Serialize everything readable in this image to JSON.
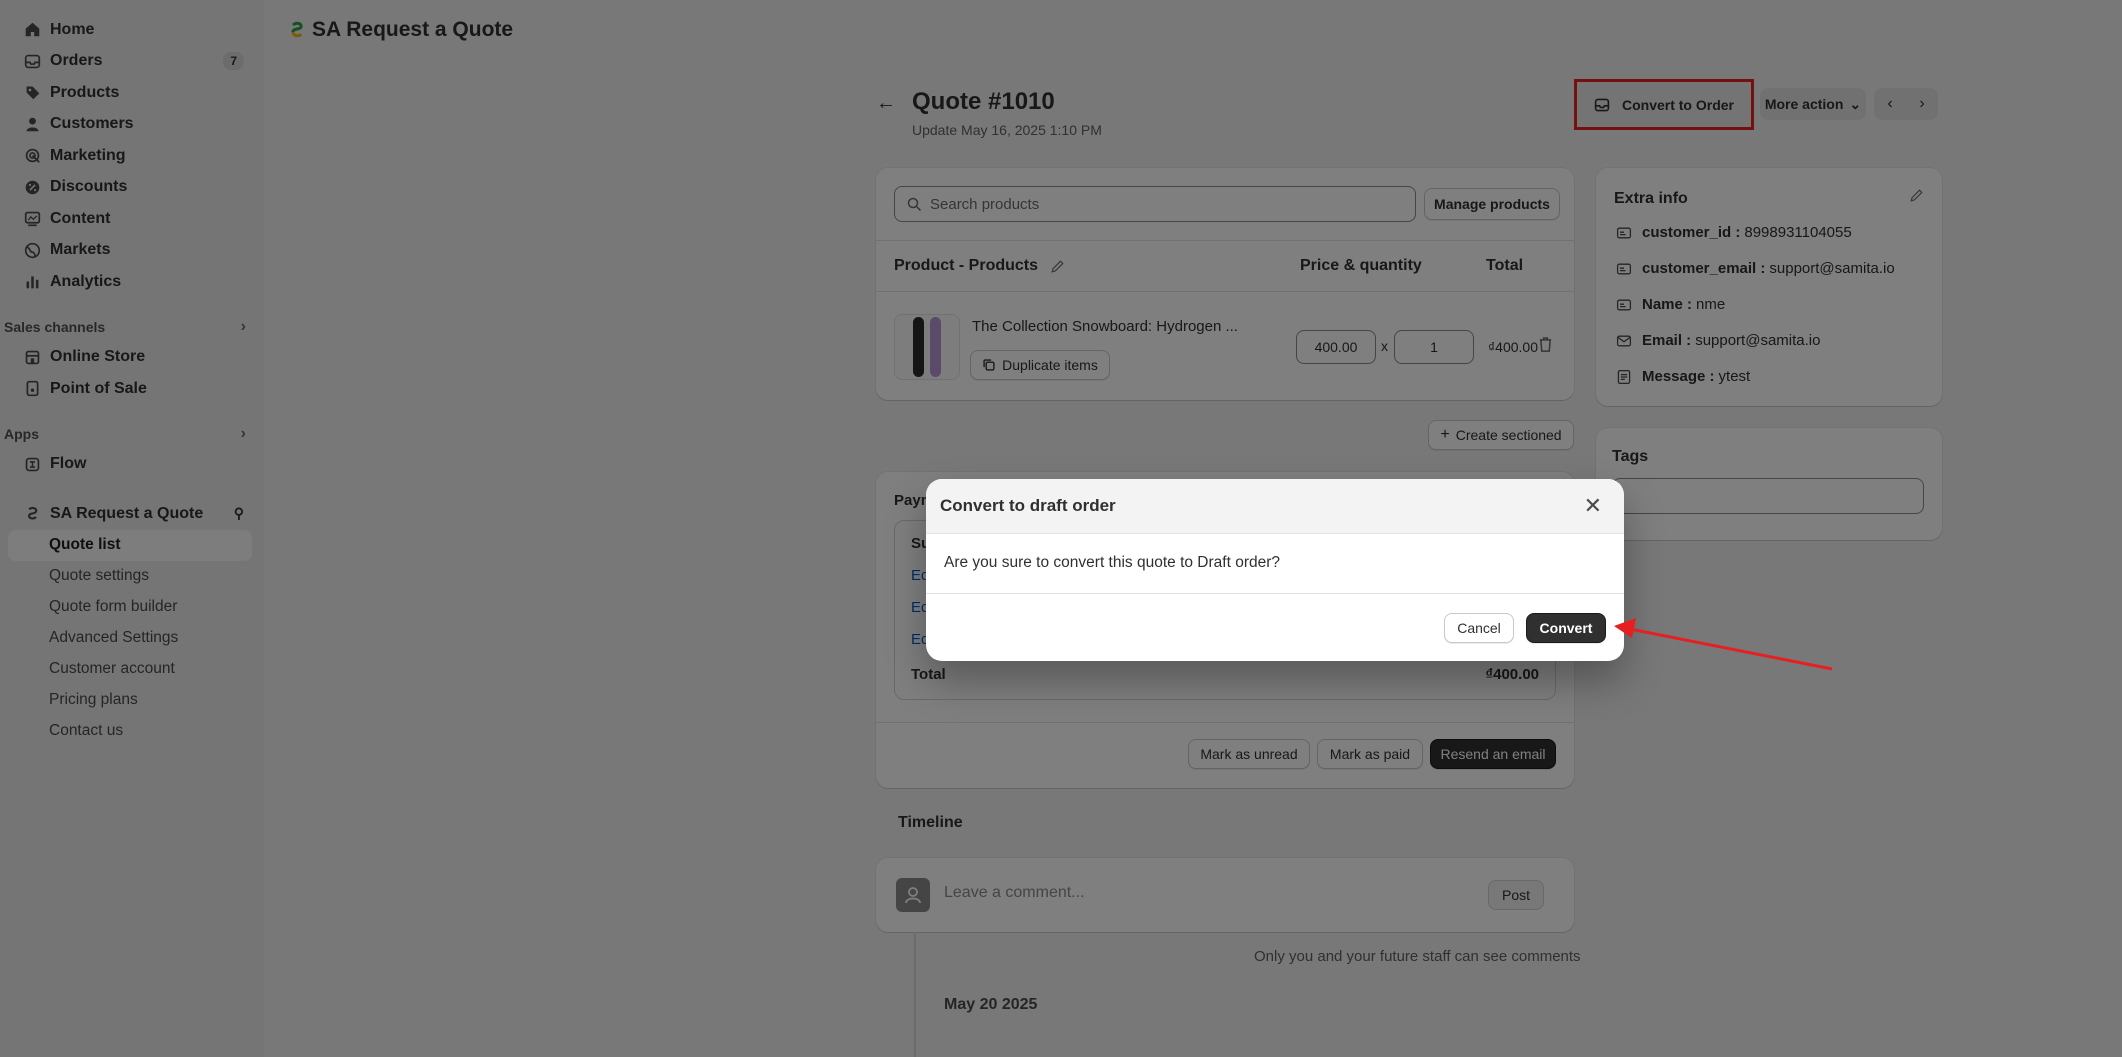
{
  "app_title": "SA Request a Quote",
  "sidebar": {
    "items": [
      {
        "label": "Home",
        "icon": "home-icon"
      },
      {
        "label": "Orders",
        "icon": "orders-icon",
        "badge": "7"
      },
      {
        "label": "Products",
        "icon": "tag-icon"
      },
      {
        "label": "Customers",
        "icon": "person-icon"
      },
      {
        "label": "Marketing",
        "icon": "target-icon"
      },
      {
        "label": "Discounts",
        "icon": "discount-icon"
      },
      {
        "label": "Content",
        "icon": "content-icon"
      },
      {
        "label": "Markets",
        "icon": "globe-icon"
      },
      {
        "label": "Analytics",
        "icon": "chart-icon"
      }
    ],
    "sales_channels_label": "Sales channels",
    "sales_channels": [
      {
        "label": "Online Store",
        "icon": "store-icon"
      },
      {
        "label": "Point of Sale",
        "icon": "pos-icon"
      }
    ],
    "apps_label": "Apps",
    "apps": [
      {
        "label": "Flow",
        "icon": "flow-icon"
      }
    ],
    "app_name": "SA Request a Quote",
    "app_sub_items": [
      "Quote list",
      "Quote settings",
      "Quote form builder",
      "Advanced Settings",
      "Customer account",
      "Pricing plans",
      "Contact us"
    ]
  },
  "header": {
    "quote_title": "Quote #1010",
    "updated": "Update May 16, 2025 1:10 PM",
    "convert_to_order": "Convert to Order",
    "more_action": "More action"
  },
  "products": {
    "search_placeholder": "Search products",
    "manage_products": "Manage products",
    "col_product": "Product - Products",
    "col_price_qty": "Price & quantity",
    "col_total": "Total",
    "item_name": "The Collection Snowboard: Hydrogen ...",
    "duplicate_items": "Duplicate items",
    "price": "400.00",
    "times": "x",
    "quantity": "1",
    "line_total": "₫400.00"
  },
  "create_sectioned": "Create sectioned",
  "payment": {
    "title": "Paym",
    "subtotal_label": "Su",
    "links": [
      "Ed",
      "Ed",
      "Ed"
    ],
    "total_label": "Total",
    "total_value": "₫400.00",
    "mark_unread": "Mark as unread",
    "mark_paid": "Mark as paid",
    "resend_email": "Resend an email"
  },
  "timeline": {
    "title": "Timeline",
    "comment_placeholder": "Leave a comment...",
    "post": "Post",
    "note": "Only you and your future staff can see comments",
    "date": "May 20 2025"
  },
  "extra_info": {
    "title": "Extra info",
    "rows": [
      {
        "key": "customer_id :",
        "value": "8998931104055"
      },
      {
        "key": "customer_email :",
        "value": "support@samita.io"
      },
      {
        "key": "Name :",
        "value": "nme"
      },
      {
        "key": "Email :",
        "value": "support@samita.io"
      },
      {
        "key": "Message :",
        "value": "ytest"
      }
    ]
  },
  "tags": {
    "title": "Tags"
  },
  "modal": {
    "title": "Convert to draft order",
    "text": "Are you sure to convert this quote to Draft order?",
    "cancel": "Cancel",
    "convert": "Convert"
  },
  "colors": {
    "highlight_red": "#e62020",
    "accent_dark": "#303030",
    "link_blue": "#005bd3"
  }
}
